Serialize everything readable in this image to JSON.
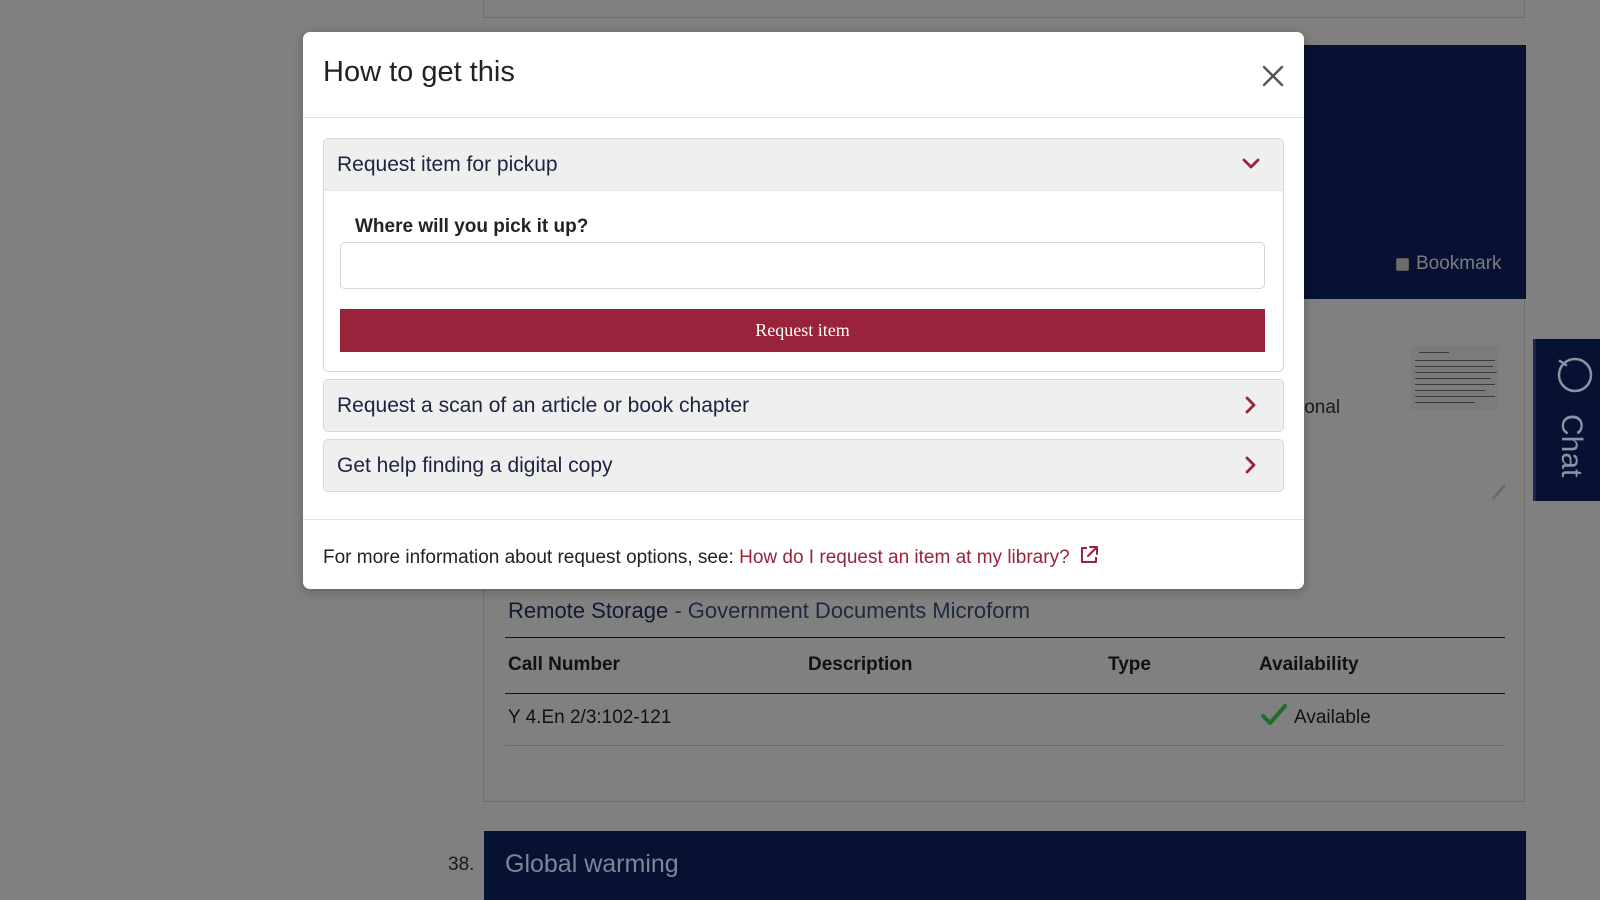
{
  "modal": {
    "title": "How to get this",
    "close_icon": "close-icon",
    "options": [
      {
        "label": "Request item for pickup",
        "icon": "chevron-down-icon",
        "expanded": true
      },
      {
        "label": "Request a scan of an article or book chapter",
        "icon": "chevron-right-icon",
        "expanded": false
      },
      {
        "label": "Get help finding a digital copy",
        "icon": "chevron-right-icon",
        "expanded": false
      }
    ],
    "pickup": {
      "question": "Where will you pick it up?",
      "input_value": "",
      "button_label": "Request item"
    },
    "footer": {
      "text": "For more information about request options, see: ",
      "link_text": "How do I request an item at my library?",
      "link_icon": "external-link-icon"
    }
  },
  "background": {
    "bookmark_label": "Bookmark",
    "partial_text": "ional",
    "location": {
      "name": "Remote Storage",
      "separator": " - ",
      "collection": "Government Documents Microform"
    },
    "holdings_table": {
      "headers": [
        "Call Number",
        "Description",
        "Type",
        "Availability"
      ],
      "rows": [
        {
          "call_number": "Y 4.En 2/3:102-121",
          "description": "",
          "type": "",
          "availability": "Available"
        }
      ]
    },
    "next_result": {
      "number": "38.",
      "title": "Global warming"
    },
    "chat_label": "Chat"
  },
  "colors": {
    "accent": "#98233a",
    "navy": "#071131",
    "overlay": "#808080"
  }
}
